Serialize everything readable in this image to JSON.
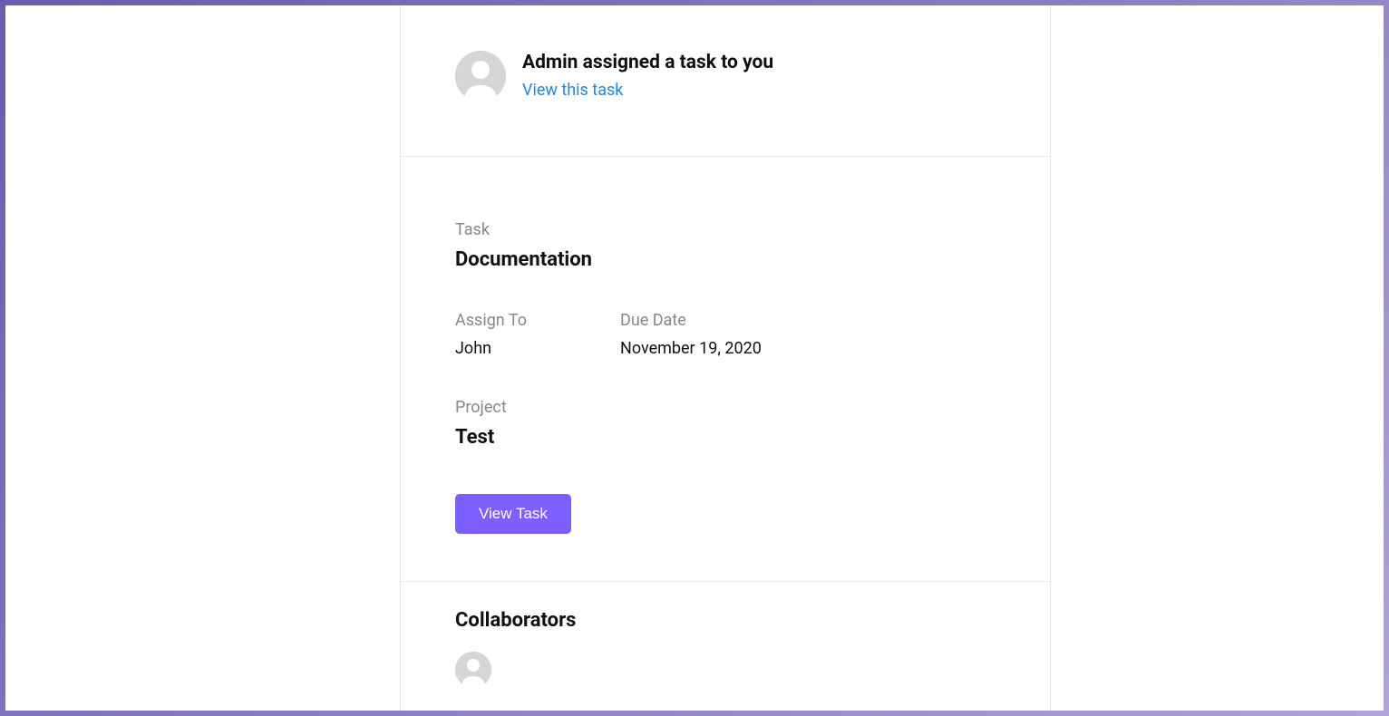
{
  "header": {
    "title": "Admin assigned a task to you",
    "link_label": "View this task"
  },
  "task": {
    "label": "Task",
    "name": "Documentation",
    "assign_to_label": "Assign To",
    "assign_to_value": "John",
    "due_date_label": "Due Date",
    "due_date_value": "November 19, 2020",
    "project_label": "Project",
    "project_value": "Test",
    "view_task_button": "View Task"
  },
  "collaborators": {
    "title": "Collaborators"
  },
  "colors": {
    "accent": "#7d5fff",
    "link": "#1e88e5"
  }
}
